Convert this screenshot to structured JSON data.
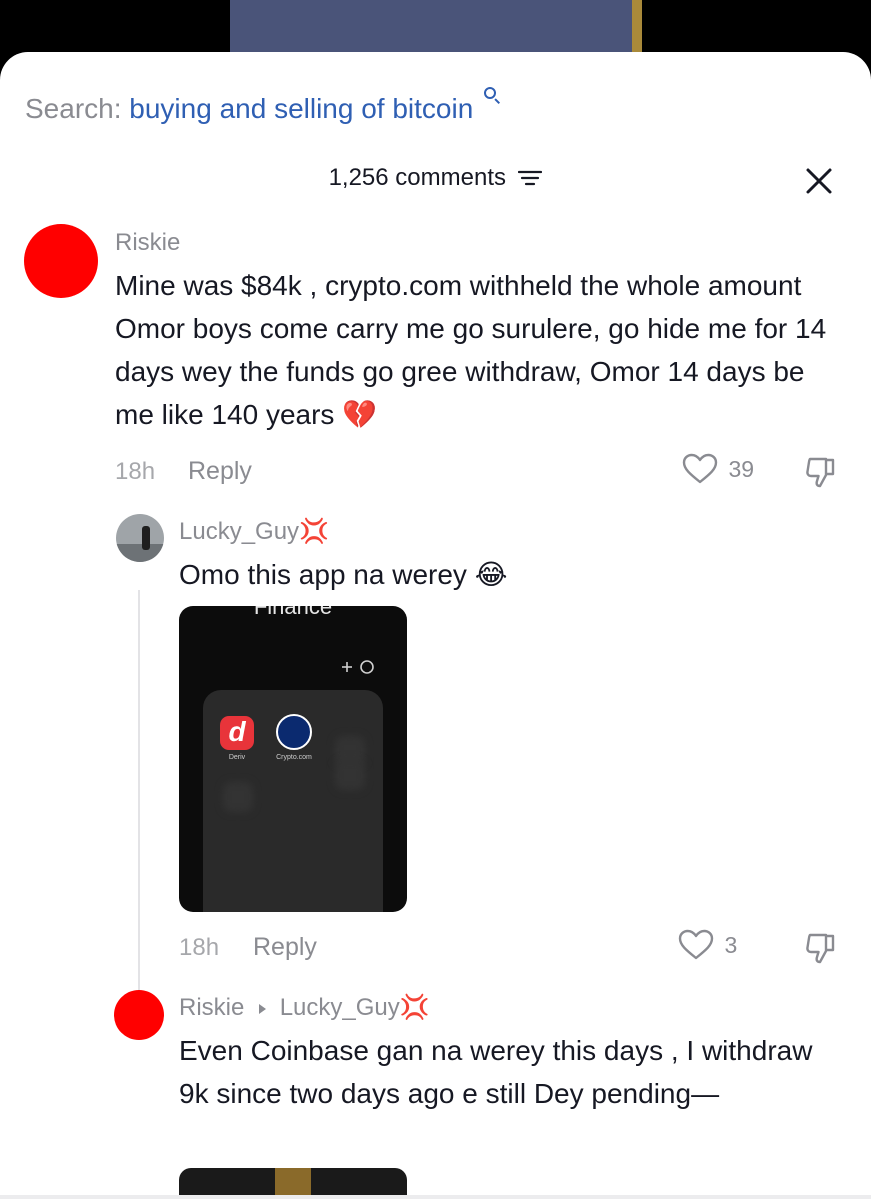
{
  "search": {
    "prefix": "Search:",
    "query": "buying and selling of bitcoin"
  },
  "header": {
    "comments_count": "1,256 comments"
  },
  "colors": {
    "link_blue": "#2f5fb3",
    "avatar_red": "#ff0000",
    "muted_gray": "#8a8b91"
  },
  "icons": {
    "search": "search-icon",
    "sort": "sort-icon",
    "close": "close-icon",
    "like": "heart-icon",
    "dislike": "thumbs-down-icon"
  },
  "comments": [
    {
      "username": "Riskie",
      "text": "Mine was $84k , crypto.com withheld the whole amount Omor boys come carry me go surulere, go hide me for 14 days wey the funds go gree withdraw, Omor 14 days be me like 140 years",
      "emoji": "💔",
      "time": "18h",
      "reply_label": "Reply",
      "likes": "39"
    },
    {
      "username": "Lucky_Guy",
      "user_emoji": "💢",
      "text": "Omo this app na werey",
      "emoji": "😂",
      "time": "18h",
      "reply_label": "Reply",
      "likes": "3",
      "attachment": {
        "folder_label": "Finance",
        "apps": [
          {
            "name": "Deriv",
            "letter": "d"
          },
          {
            "name": "Crypto.com"
          }
        ]
      }
    },
    {
      "username": "Riskie",
      "reply_to": "Lucky_Guy",
      "reply_to_emoji": "💢",
      "text": "Even Coinbase gan na werey this days , I withdraw 9k since two days ago e still Dey pending—"
    }
  ]
}
